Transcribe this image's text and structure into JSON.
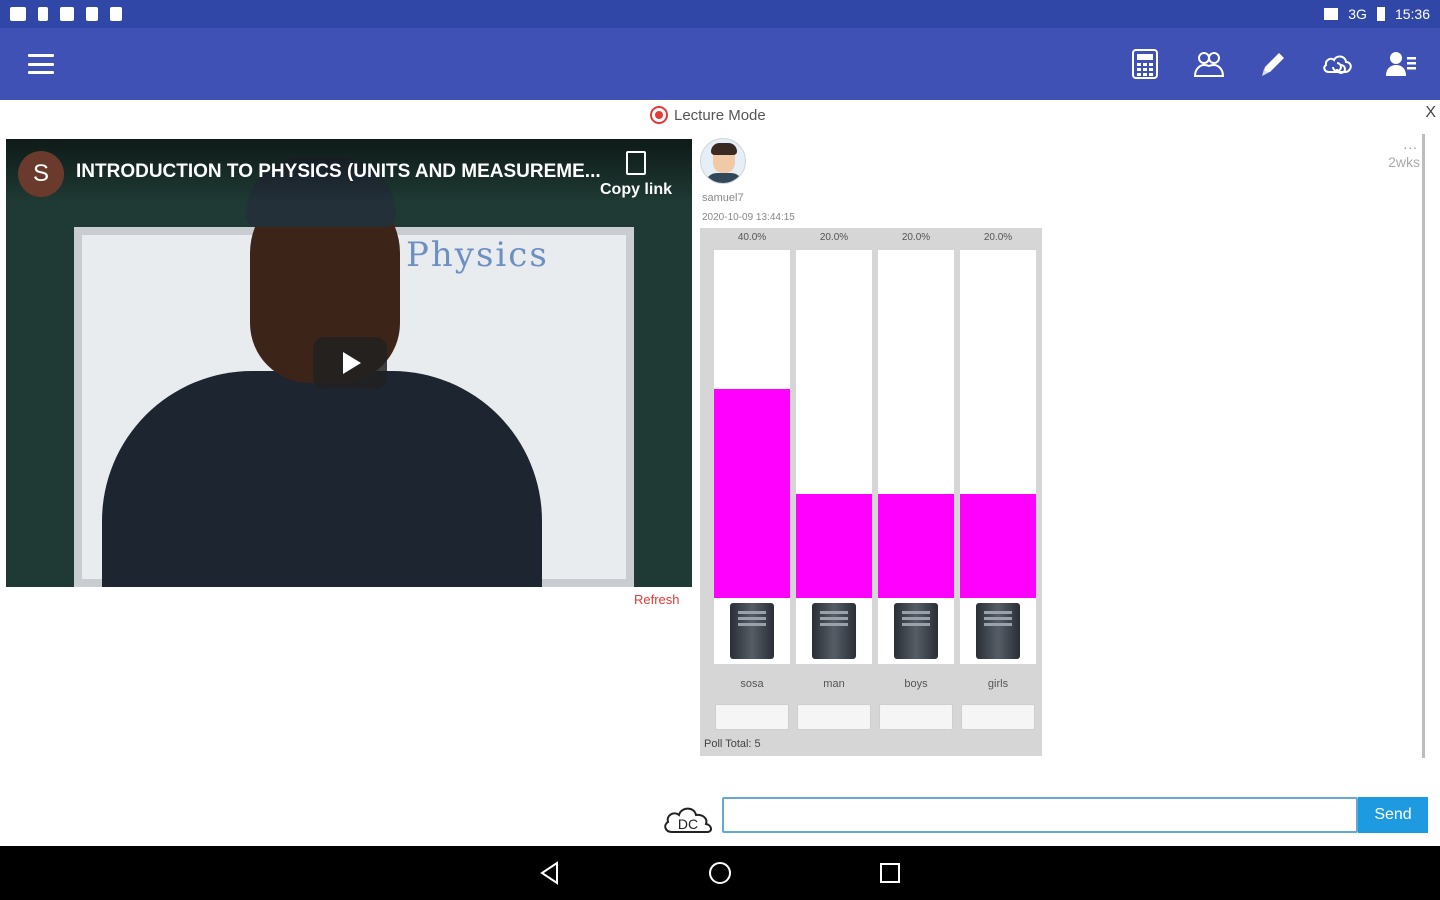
{
  "status_bar": {
    "network": "3G",
    "time": "15:36"
  },
  "toolbar": {
    "menu_icon": "hamburger-menu-icon",
    "actions": [
      "calculator-icon",
      "users-group-icon",
      "pencil-icon",
      "cloud-sync-icon",
      "contacts-icon"
    ]
  },
  "lecture": {
    "mode_label": "Lecture Mode",
    "close_label": "X"
  },
  "video": {
    "channel_initial": "S",
    "title": "INTRODUCTION TO PHYSICS (UNITS AND MEASUREME...",
    "copy_link_label": "Copy link",
    "board_text": "Physics",
    "refresh_label": "Refresh"
  },
  "post": {
    "more_label": "...",
    "time_ago": "2wks",
    "username": "samuel7",
    "date": "2020-10-09 13:44:15"
  },
  "chart_data": {
    "type": "bar",
    "categories": [
      "sosa",
      "man",
      "boys",
      "girls"
    ],
    "values": [
      40.0,
      20.0,
      20.0,
      20.0
    ],
    "value_labels": [
      "40.0%",
      "20.0%",
      "20.0%",
      "20.0%"
    ],
    "ylim": [
      0,
      100
    ],
    "bar_color": "#ff00ff",
    "total_label": "Poll Total: 5"
  },
  "composer": {
    "logo_text": "DC",
    "input_value": "",
    "send_label": "Send"
  },
  "colors": {
    "toolbar": "#3f51b5",
    "status_bar": "#3047a8",
    "send_button": "#1e9be0",
    "record": "#e53935"
  }
}
